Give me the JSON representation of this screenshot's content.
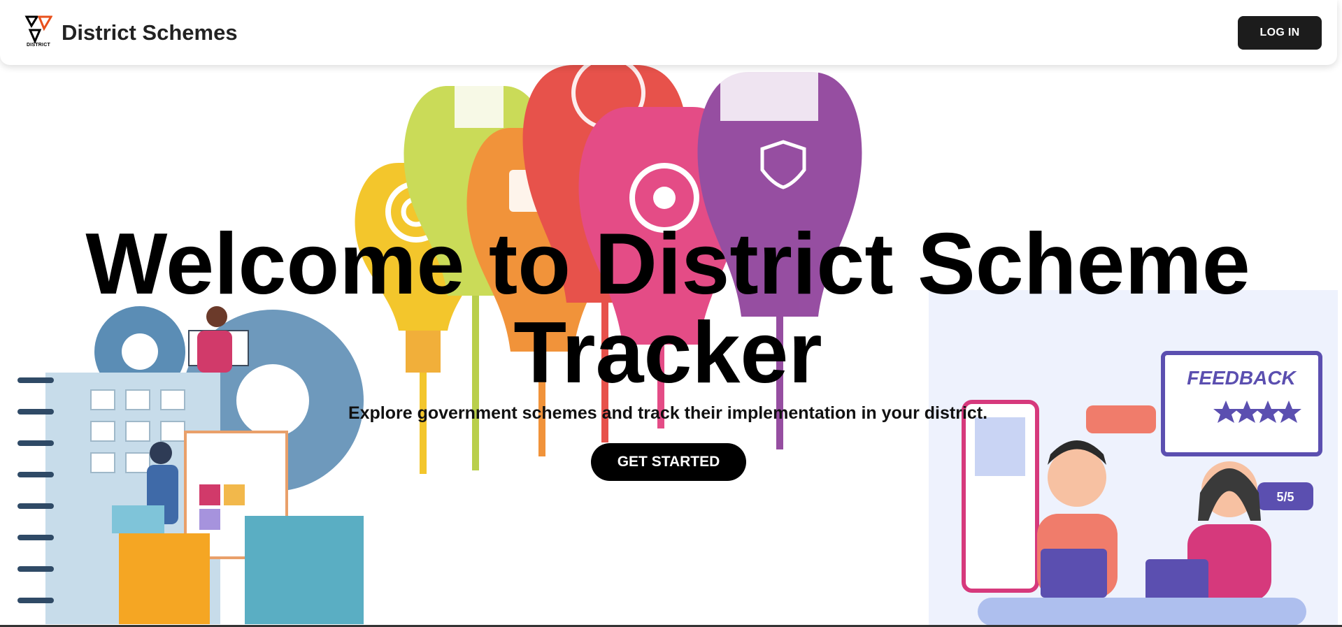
{
  "header": {
    "logo_text": "DISTRICT",
    "brand_name": "District Schemes",
    "login_label": "LOG IN"
  },
  "hero": {
    "title": "Welcome to District Scheme Tracker",
    "subtitle": "Explore government schemes and track their implementation in your district.",
    "cta_label": "GET STARTED"
  },
  "illustrations": {
    "feedback_title": "FEEDBACK",
    "feedback_rating": "5/5"
  },
  "colors": {
    "primary": "#000000",
    "bulb_yellow": "#f2c21b",
    "bulb_lime": "#c6d84a",
    "bulb_orange": "#f08a2a",
    "bulb_red": "#e6443c",
    "bulb_pink": "#e23d7c",
    "bulb_purple": "#8e3f9a",
    "feedback_purple": "#5b4fb0",
    "gear_blue": "#5b8db5"
  }
}
